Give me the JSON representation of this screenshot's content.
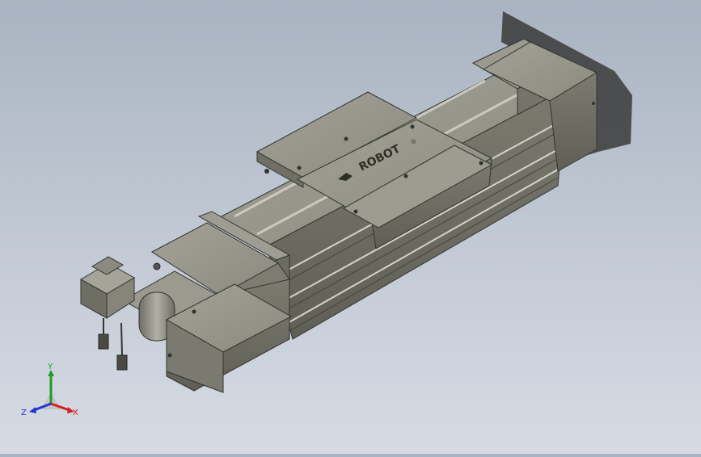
{
  "viewport": {
    "model_logo_text": "ROBOT",
    "logo_registered_mark": "®",
    "colors": {
      "background_top": "#a9b3c1",
      "background_bottom": "#d6dbe3",
      "body": "#8b8b80",
      "body_dark": "#6c6c63",
      "body_light": "#a6a69b",
      "shadow": "#3a3a3a"
    }
  },
  "triad": {
    "x_label": "X",
    "y_label": "Y",
    "z_label": "Z",
    "colors": {
      "x": "#d42020",
      "y": "#1d9c2a",
      "z": "#2433d6"
    }
  }
}
